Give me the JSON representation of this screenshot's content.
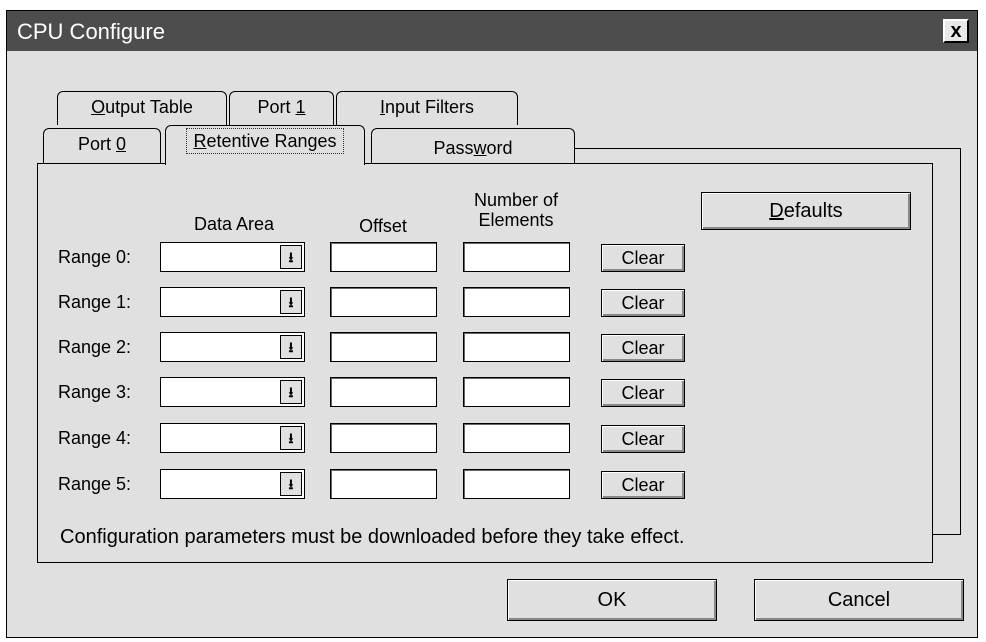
{
  "window": {
    "title": "CPU Configure",
    "close_glyph": "x"
  },
  "tabs": {
    "back_row": [
      {
        "pre": "",
        "ul": "O",
        "post": "utput Table"
      },
      {
        "pre": "Port ",
        "ul": "1",
        "post": ""
      },
      {
        "pre": "",
        "ul": "I",
        "post": "nput Filters"
      }
    ],
    "front_row": [
      {
        "pre": "Port ",
        "ul": "0",
        "post": ""
      },
      {
        "pre": "",
        "ul": "R",
        "post": "etentive Ranges",
        "selected": true
      },
      {
        "pre": "Pass",
        "ul": "w",
        "post": "ord"
      }
    ]
  },
  "columns": {
    "data_area": "Data Area",
    "offset": "Offset",
    "num_elements_line1": "Number of",
    "num_elements_line2": "Elements"
  },
  "ranges": [
    {
      "label": "Range 0:",
      "data_area": "",
      "offset": "",
      "elements": ""
    },
    {
      "label": "Range 1:",
      "data_area": "",
      "offset": "",
      "elements": ""
    },
    {
      "label": "Range 2:",
      "data_area": "",
      "offset": "",
      "elements": ""
    },
    {
      "label": "Range 3:",
      "data_area": "",
      "offset": "",
      "elements": ""
    },
    {
      "label": "Range 4:",
      "data_area": "",
      "offset": "",
      "elements": ""
    },
    {
      "label": "Range 5:",
      "data_area": "",
      "offset": "",
      "elements": ""
    }
  ],
  "clear_label": "Clear",
  "dropdown_icon": "arrow-down-icon",
  "defaults": {
    "ul": "D",
    "post": "efaults"
  },
  "note": "Configuration parameters must be downloaded before they take effect.",
  "buttons": {
    "ok": "OK",
    "cancel": "Cancel"
  },
  "colors": {
    "title_bar": "#4d4d4d",
    "face": "#e0e0e0"
  }
}
